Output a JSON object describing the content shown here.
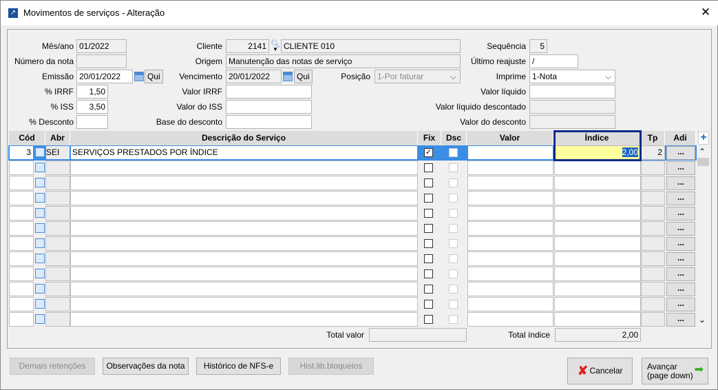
{
  "window": {
    "title": "Movimentos de serviços - Alteração",
    "close": "✕"
  },
  "form": {
    "mes_ano": {
      "label": "Mês/ano",
      "value": "01/2022"
    },
    "numero_nota": {
      "label": "Número da nota",
      "value": ""
    },
    "emissao": {
      "label": "Emissão",
      "value": "20/01/2022",
      "day": "Qui"
    },
    "irrf": {
      "label": "% IRRF",
      "value": "1,50"
    },
    "iss": {
      "label": "% ISS",
      "value": "3,50"
    },
    "desconto": {
      "label": "% Desconto",
      "value": ""
    },
    "cliente": {
      "label": "Cliente",
      "code": "2141",
      "name": "CLIENTE 010"
    },
    "origem": {
      "label": "Origem",
      "value": "Manutenção das notas de serviço"
    },
    "vencimento": {
      "label": "Vencimento",
      "value": "20/01/2022",
      "day": "Qui"
    },
    "posicao": {
      "label": "Posição",
      "value": "1-Por faturar"
    },
    "valor_irrf": {
      "label": "Valor IRRF",
      "value": ""
    },
    "valor_iss": {
      "label": "Valor do ISS",
      "value": ""
    },
    "base_desconto": {
      "label": "Base do desconto",
      "value": ""
    },
    "sequencia": {
      "label": "Sequência",
      "value": "5"
    },
    "ultimo_reajuste": {
      "label": "Último reajuste",
      "value": "/"
    },
    "imprime": {
      "label": "Imprime",
      "value": "1-Nota"
    },
    "valor_liquido": {
      "label": "Valor líquido",
      "value": ""
    },
    "valor_liquido_desc": {
      "label": "Valor líquido descontado",
      "value": ""
    },
    "valor_desconto": {
      "label": "Valor do desconto",
      "value": ""
    }
  },
  "grid": {
    "headers": {
      "cod": "Cód",
      "abr": "Abr",
      "desc": "Descrição do Serviço",
      "fix": "Fix",
      "dsc": "Dsc",
      "valor": "Valor",
      "indice": "Índice",
      "tp": "Tp",
      "adi": "Adi"
    },
    "rows": [
      {
        "cod": "3",
        "abr": "SEI",
        "desc": "SERVIÇOS PRESTADOS POR ÍNDICE",
        "fix": true,
        "dsc": false,
        "valor": "",
        "indice": "2,00",
        "tp": "2"
      }
    ],
    "empty_rows": 11,
    "dots": "..."
  },
  "totals": {
    "valor_label": "Total valor",
    "valor": "",
    "indice_label": "Total índice",
    "indice": "2,00"
  },
  "buttons": {
    "demais": "Demais retenções",
    "observacoes": "Observações da nota",
    "historico": "Histórico de NFS-e",
    "hist_lib": "Hist.lib.bloqueios",
    "cancelar": "Cancelar",
    "avancar1": "Avançar",
    "avancar2": "(page down)"
  }
}
